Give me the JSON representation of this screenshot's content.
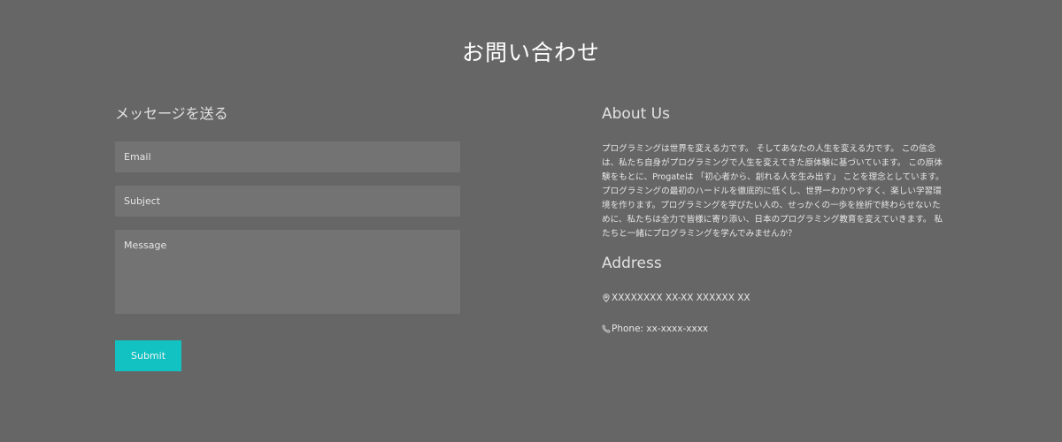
{
  "page": {
    "title": "お問い合わせ"
  },
  "form": {
    "heading": "メッセージを送る",
    "email_placeholder": "Email",
    "subject_placeholder": "Subject",
    "message_placeholder": "Message",
    "submit_label": "Submit"
  },
  "about": {
    "heading": "About Us",
    "body": "プログラミングは世界を変える力です。 そしてあなたの人生を変える力です。 この信念は、私たち自身がプログラミングで人生を変えてきた原体験に基づいています。 この原体験をもとに、Progateは 「初心者から、創れる人を生み出す」 ことを理念としています。 プログラミングの最初のハードルを徹底的に低くし、世界一わかりやすく、楽しい学習環境を作ります。プログラミングを学びたい人の、せっかくの一歩を挫折で終わらせないために、私たちは全力で皆様に寄り添い、日本のプログラミング教育を変えていきます。 私たちと一緒にプログラミングを学んでみませんか？"
  },
  "address": {
    "heading": "Address",
    "location": "XXXXXXXX XX-XX XXXXXX XX",
    "location_icon": "map-pin-icon",
    "phone": "Phone: xx-xxxx-xxxx",
    "phone_icon": "phone-icon"
  },
  "colors": {
    "background": "#666666",
    "field_background": "#737373",
    "accent": "#12c2c2"
  }
}
